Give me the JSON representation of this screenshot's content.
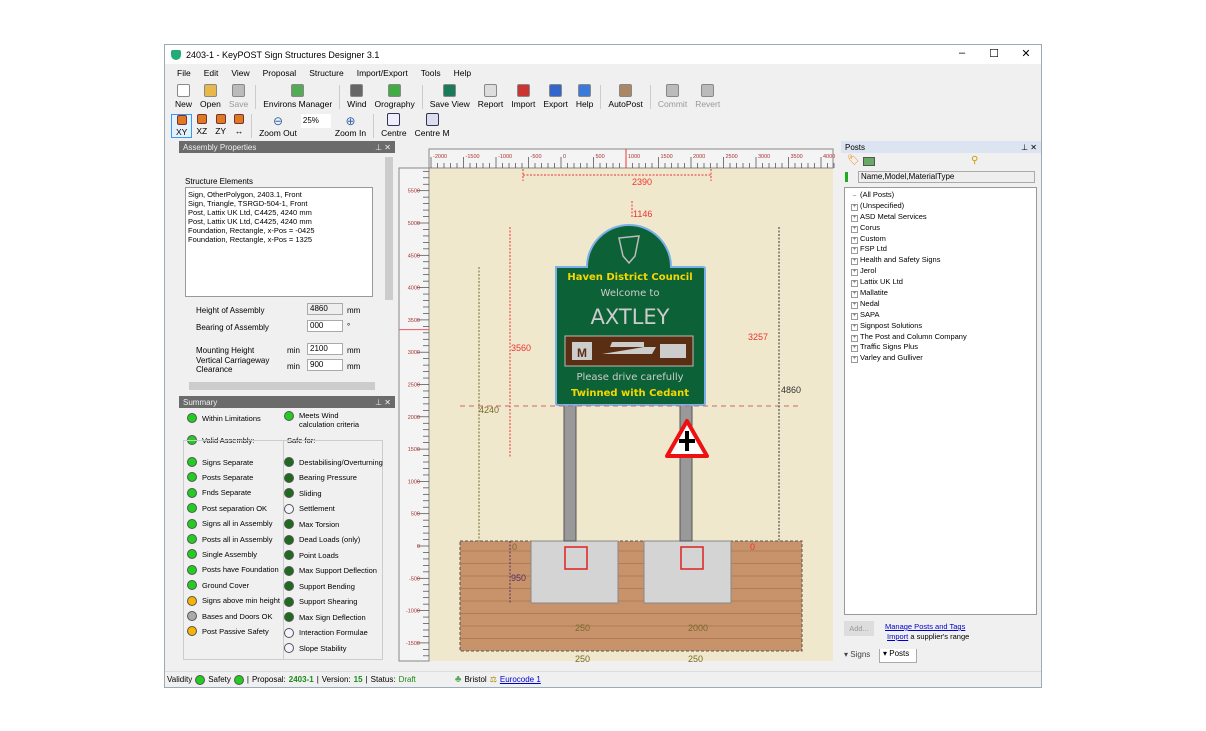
{
  "window": {
    "title": "2403-1 - KeyPOST Sign Structures Designer 3.1",
    "minimize": "–",
    "maximize": "☐",
    "close": "✕"
  },
  "menu": [
    "File",
    "Edit",
    "View",
    "Proposal",
    "Structure",
    "Import/Export",
    "Tools",
    "Help"
  ],
  "toolbar1": [
    {
      "label": "New",
      "icon": "new-file-icon",
      "color": "#fff",
      "enabled": true
    },
    {
      "label": "Open",
      "icon": "folder-open-icon",
      "color": "#e8b84a",
      "enabled": true
    },
    {
      "label": "Save",
      "icon": "save-icon",
      "color": "#bbb",
      "enabled": false
    },
    {
      "label": "Environs Manager",
      "icon": "map-uk-icon",
      "color": "#5a5",
      "enabled": true
    },
    {
      "label": "Wind",
      "icon": "wind-icon",
      "color": "#666",
      "enabled": true
    },
    {
      "label": "Orography",
      "icon": "orography-icon",
      "color": "#4a4",
      "enabled": true
    },
    {
      "label": "Save View",
      "icon": "save-view-icon",
      "color": "#1a7a5a",
      "enabled": true
    },
    {
      "label": "Report",
      "icon": "report-icon",
      "color": "#ddd",
      "enabled": true
    },
    {
      "label": "Import",
      "icon": "import-icon",
      "color": "#c33",
      "enabled": true
    },
    {
      "label": "Export",
      "icon": "export-icon",
      "color": "#36c",
      "enabled": true
    },
    {
      "label": "Help",
      "icon": "help-icon",
      "color": "#3a7ad8",
      "enabled": true
    },
    {
      "label": "AutoPost",
      "icon": "autopost-icon",
      "color": "#a86",
      "enabled": true
    },
    {
      "label": "Commit",
      "icon": "commit-icon",
      "color": "#bbb",
      "enabled": false
    },
    {
      "label": "Revert",
      "icon": "revert-icon",
      "color": "#bbb",
      "enabled": false
    }
  ],
  "toolbar2": {
    "views": [
      "XY",
      "XZ",
      "ZY",
      "↔"
    ],
    "zoom_out": "Zoom Out",
    "zoom_level": "25%",
    "zoom_in": "Zoom In",
    "centre": "Centre",
    "centre_m": "Centre M"
  },
  "assembly": {
    "title": "Assembly Properties",
    "elements_label": "Structure Elements",
    "elements": [
      "Sign, OtherPolygon, 2403.1, Front",
      "Sign, Triangle, TSRGD-504-1, Front",
      "Post, Lattix UK Ltd, C4425, 4240 mm",
      "Post, Lattix UK Ltd, C4425, 4240 mm",
      "Foundation, Rectangle, x-Pos = -0425",
      "Foundation, Rectangle, x-Pos = 1325"
    ],
    "height_label": "Height of Assembly",
    "height": "4860",
    "height_unit": "mm",
    "bearing_label": "Bearing of Assembly",
    "bearing": "000",
    "bearing_unit": "°",
    "mounting_label": "Mounting Height",
    "mounting_min": "min",
    "mounting": "2100",
    "mounting_unit": "mm",
    "clearance_label": "Vertical Carriageway Clearance",
    "clearance_min": "min",
    "clearance": "900",
    "clearance_unit": "mm"
  },
  "summary": {
    "title": "Summary",
    "within": "Within Limitations",
    "wind": "Meets Wind calculation criteria",
    "valid": "Valid Assembly:",
    "safe": "Safe for:",
    "colors": {
      "green": "#22cc22",
      "orange": "#f5b400",
      "grey": "#aaaaaa",
      "dark": "#1f6a1f",
      "empty": "#f4f4ff"
    },
    "left": [
      {
        "label": "Signs Separate",
        "status": "green"
      },
      {
        "label": "Posts Separate",
        "status": "green"
      },
      {
        "label": "Fnds Separate",
        "status": "green"
      },
      {
        "label": "Post separation OK",
        "status": "green"
      },
      {
        "label": "Signs all in Assembly",
        "status": "green"
      },
      {
        "label": "Posts all in Assembly",
        "status": "green"
      },
      {
        "label": "Single Assembly",
        "status": "green"
      },
      {
        "label": "Posts have Foundation",
        "status": "green"
      },
      {
        "label": "Ground Cover",
        "status": "green"
      },
      {
        "label": "Signs above min height",
        "status": "orange"
      },
      {
        "label": "Bases and Doors OK",
        "status": "grey"
      },
      {
        "label": "Post Passive Safety",
        "status": "orange"
      }
    ],
    "right": [
      {
        "label": "Destabilising/Overturning",
        "status": "dark"
      },
      {
        "label": "Bearing Pressure",
        "status": "dark"
      },
      {
        "label": "Sliding",
        "status": "dark"
      },
      {
        "label": "Settlement",
        "status": "empty"
      },
      {
        "label": "Max Torsion",
        "status": "dark"
      },
      {
        "label": "Dead Loads (only)",
        "status": "dark"
      },
      {
        "label": "Point Loads",
        "status": "dark"
      },
      {
        "label": "Max Support Deflection",
        "status": "dark"
      },
      {
        "label": "Support Bending",
        "status": "dark"
      },
      {
        "label": "Support Shearing",
        "status": "dark"
      },
      {
        "label": "Max Sign Deflection",
        "status": "dark"
      },
      {
        "label": "Interaction Formulae",
        "status": "empty"
      },
      {
        "label": "Slope Stability",
        "status": "empty"
      }
    ]
  },
  "canvas": {
    "x_ruler": [
      "-2000",
      "-1500",
      "-1000",
      "-500",
      "0",
      "500",
      "1000",
      "1500",
      "2000",
      "2500",
      "3000",
      "3500",
      "4000"
    ],
    "y_ruler": [
      "5500",
      "5000",
      "4500",
      "4000",
      "3500",
      "3000",
      "2500",
      "2000",
      "1500",
      "1000",
      "500",
      "0",
      "-500",
      "-1000",
      "-1500"
    ],
    "sign": {
      "line1": "Haven District Council",
      "line2": "Welcome to",
      "line3": "AXTLEY",
      "line4": "Please drive carefully",
      "line5": "Twinned with Cedant",
      "museum": "M",
      "green": "#0c6236",
      "brown": "#5a2e12",
      "yellow": "#f5d800"
    },
    "dims": {
      "width": "2390",
      "top": "1146",
      "d3560": "3560",
      "d3257": "3257",
      "d4860": "4860",
      "d4240": "4240",
      "zero_left": "0",
      "d950": "950",
      "zero_right": "0",
      "f1": "250",
      "f2": "2000",
      "b1": "250",
      "b2": "250"
    }
  },
  "posts": {
    "title": "Posts",
    "filter": "Name,Model,MaterialType",
    "items": [
      "(All Posts)",
      "(Unspecified)",
      "ASD Metal Services",
      "Corus",
      "Custom",
      "FSP Ltd",
      "Health and Safety Signs",
      "Jerol",
      "Lattix UK Ltd",
      "Mallatite",
      "Nedal",
      "SAPA",
      "Signpost Solutions",
      "The Post and Column Company",
      "Traffic Signs Plus",
      "Varley and Gulliver"
    ],
    "add": "Add...",
    "manage": "Manage Posts and Tags",
    "import_link": "Import",
    "import_rest": " a supplier's range",
    "tabs": [
      "Signs",
      "Posts"
    ]
  },
  "status": {
    "validity": "Validity",
    "safety": "Safety",
    "proposal_label": "Proposal:",
    "proposal": "2403-1",
    "version_label": "Version:",
    "version": "15",
    "status_label": "Status:",
    "status": "Draft",
    "location": "Bristol",
    "code": "Eurocode 1"
  }
}
